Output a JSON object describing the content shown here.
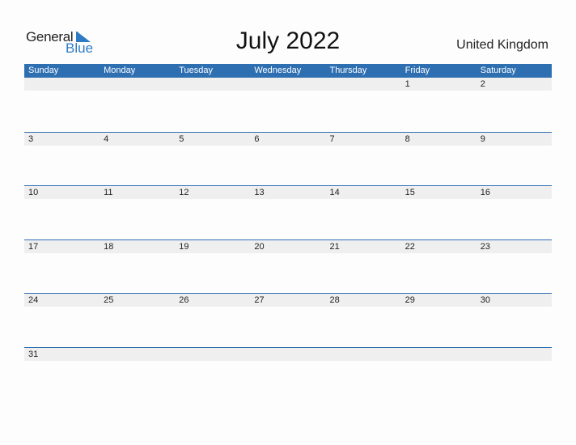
{
  "logo": {
    "line1": "General",
    "line2": "Blue"
  },
  "title": "July 2022",
  "country": "United Kingdom",
  "colors": {
    "accent": "#2E6FB2",
    "strip": "#EFEFEF"
  },
  "weekdays": [
    "Sunday",
    "Monday",
    "Tuesday",
    "Wednesday",
    "Thursday",
    "Friday",
    "Saturday"
  ],
  "weeks": [
    [
      "",
      "",
      "",
      "",
      "",
      "1",
      "2"
    ],
    [
      "3",
      "4",
      "5",
      "6",
      "7",
      "8",
      "9"
    ],
    [
      "10",
      "11",
      "12",
      "13",
      "14",
      "15",
      "16"
    ],
    [
      "17",
      "18",
      "19",
      "20",
      "21",
      "22",
      "23"
    ],
    [
      "24",
      "25",
      "26",
      "27",
      "28",
      "29",
      "30"
    ],
    [
      "31",
      "",
      "",
      "",
      "",
      "",
      ""
    ]
  ]
}
